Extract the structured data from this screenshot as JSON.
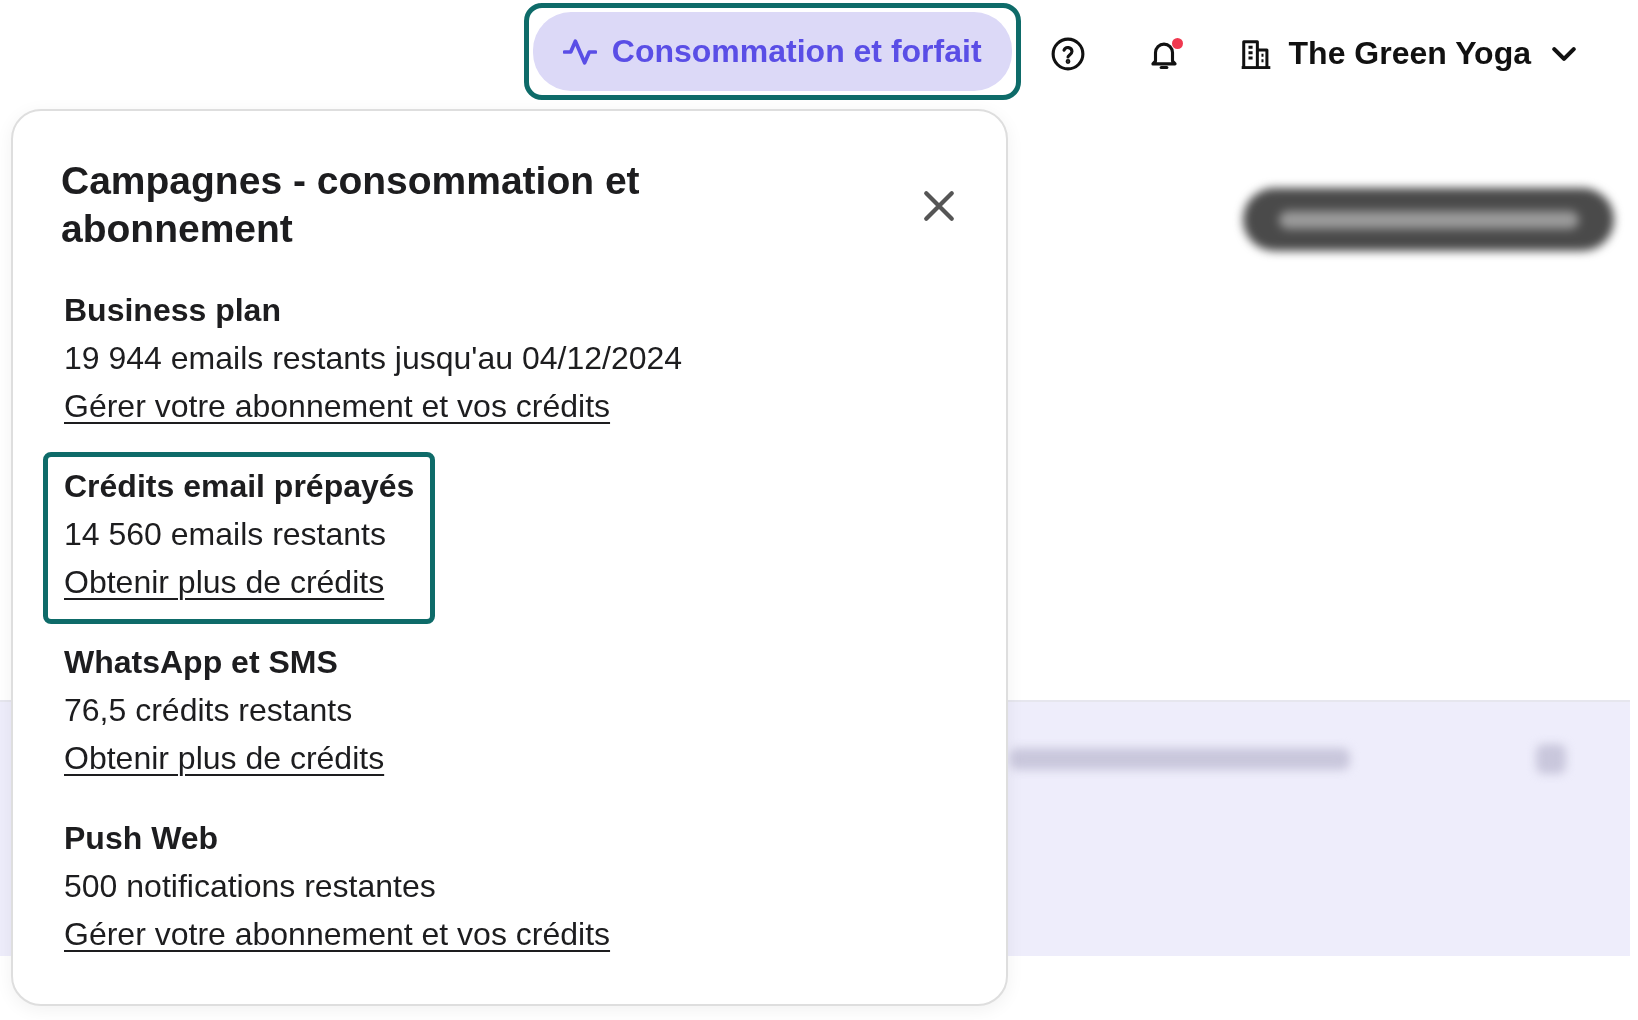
{
  "header": {
    "usage_button": {
      "label": "Consommation et forfait",
      "highlighted": true
    },
    "notifications": {
      "unread": true
    },
    "account": {
      "name": "The Green Yoga"
    }
  },
  "popup": {
    "title": "Campagnes - consommation et abonnement",
    "sections": [
      {
        "title": "Business plan",
        "detail": "19 944 emails restants jusqu'au 04/12/2024",
        "link": "Gérer votre abonnement et vos crédits",
        "highlighted": false
      },
      {
        "title": "Crédits email prépayés",
        "detail": "14 560 emails restants",
        "link": "Obtenir plus de crédits",
        "highlighted": true
      },
      {
        "title": "WhatsApp et SMS",
        "detail": "76,5 crédits restants",
        "link": "Obtenir plus de crédits",
        "highlighted": false
      },
      {
        "title": "Push Web",
        "detail": "500 notifications restantes",
        "link": "Gérer votre abonnement et vos crédits",
        "highlighted": false
      }
    ]
  }
}
